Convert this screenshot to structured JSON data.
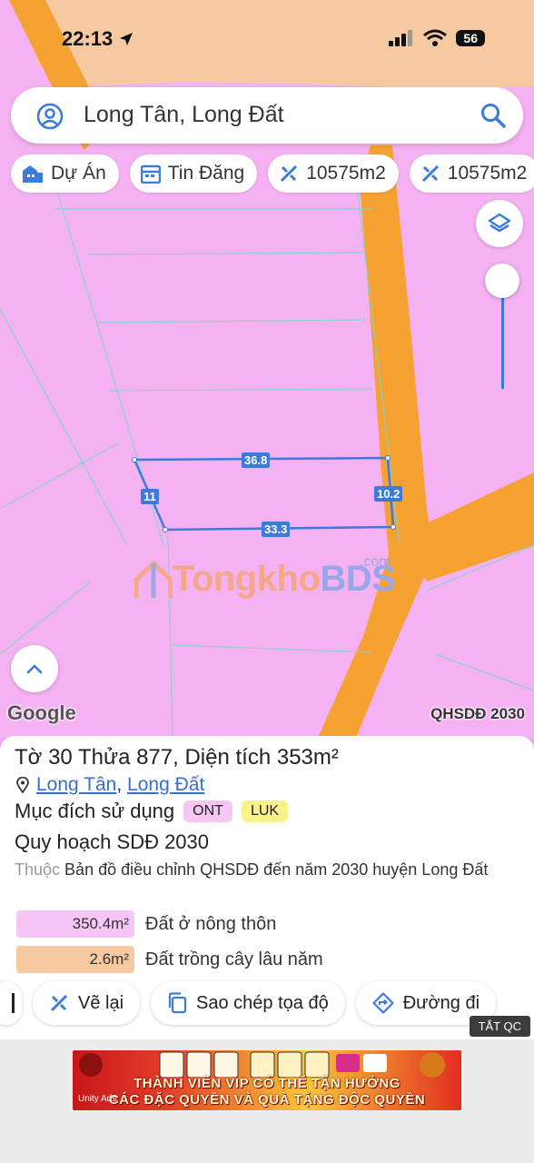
{
  "status_bar": {
    "time": "22:13",
    "battery": "56"
  },
  "search": {
    "query": "Long Tân, Long Đất"
  },
  "chips": [
    {
      "label": "Dự Án",
      "icon": "building-icon"
    },
    {
      "label": "Tin Đăng",
      "icon": "calendar-icon"
    },
    {
      "label": "10575m2",
      "icon": "measure-icon"
    },
    {
      "label": "10575m2",
      "icon": "measure-icon"
    }
  ],
  "map": {
    "dimensions": {
      "top": "36.8",
      "left": "11",
      "right": "10.2",
      "bottom": "33.3"
    },
    "watermark": {
      "part1": "Tongkho",
      "part2": "BDS",
      "suffix": ".com"
    },
    "google_label": "Google",
    "layer_label": "QHSDĐ 2030"
  },
  "parcel": {
    "title": "Tờ 30 Thửa 877, Diện tích 353m²",
    "location": {
      "commune": "Long Tân",
      "district": "Long Đất",
      "separator": ","
    },
    "usage_label": "Mục đích sử dụng",
    "usage_codes": [
      "ONT",
      "LUK"
    ],
    "plan_title": "Quy hoạch SDĐ 2030",
    "plan_prefix": "Thuộc",
    "plan_desc": "Bản đồ điều chỉnh QHSDĐ đến năm 2030 huyện Long Đất",
    "land_uses": [
      {
        "area": "350.4m²",
        "label": "Đất ở nông thôn",
        "color": "#f6c7f6"
      },
      {
        "area": "2.6m²",
        "label": "Đất trồng cây lâu năm",
        "color": "#f7c9a0"
      }
    ]
  },
  "actions": [
    {
      "label": "Vẽ lại",
      "icon": "ruler-icon"
    },
    {
      "label": "Sao chép tọa độ",
      "icon": "copy-icon"
    },
    {
      "label": "Đường đi",
      "icon": "directions-icon"
    }
  ],
  "ad": {
    "close_label": "TẮT QC",
    "line1": "THÀNH VIÊN VIP CÓ THỂ TẬN HƯỞNG",
    "line2": "CÁC ĐẶC QUYỀN VÀ QUÀ TẶNG ĐỘC QUYỀN",
    "brand": "Unity Ads"
  },
  "colors": {
    "map_pink": "#f5b2f2",
    "road_orange": "#f5a233",
    "parcel_blue": "#3c7bd9"
  }
}
